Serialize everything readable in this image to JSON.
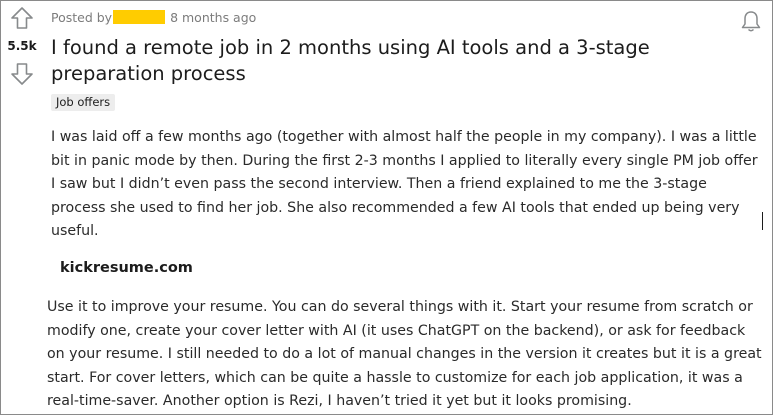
{
  "vote": {
    "score": "5.5k"
  },
  "post": {
    "posted_prefix": "Posted by",
    "time_ago": "8 months ago",
    "title": "I found a remote job in 2 months using AI tools and a 3-stage preparation process",
    "flair": "Job offers",
    "paragraph_1": "I was laid off a few months ago (together with almost half the people in my company). I was a little bit in panic mode by then. During the first 2-3 months I applied to literally every single PM job offer I saw but I didn’t even pass the second interview. Then a friend explained to me the 3-stage process she used to find her job. She also recommended a few AI tools that ended up being very useful.",
    "link_heading": "kickresume.com",
    "paragraph_2": "Use it to improve your resume. You can do several things with it. Start your resume from scratch or modify one, create your cover letter with AI (it uses ChatGPT on the backend), or ask for feedback on your resume. I still needed to do a lot of manual changes in the version it creates but it is a great start. For cover letters, which can be quite a hassle to customize for each job application, it was a real-time-saver. Another option is Rezi, I haven’t tried it yet but it looks promising."
  },
  "icons": {
    "upvote": "arrow-up-outline",
    "downvote": "arrow-down-outline",
    "notify": "bell-outline"
  },
  "colors": {
    "redaction": "#ffcc00",
    "meta_text": "#7c7c7c",
    "flair_bg": "#ededed"
  }
}
